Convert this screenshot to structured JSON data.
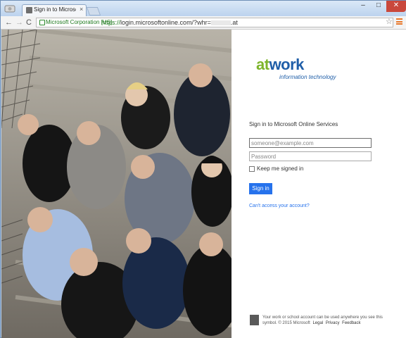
{
  "browser": {
    "tab_title": "Sign in to Microsoft Onlin",
    "tab_close": "×",
    "window_controls": {
      "minimize": "–",
      "maximize": "□",
      "close": "✕"
    },
    "nav": {
      "back": "←",
      "forward": "→",
      "reload": "C"
    },
    "address": {
      "organization": "Microsoft Corporation [US]",
      "url_scheme": "https://",
      "url_rest": "login.microsoftonline.com/?whr=",
      "url_tail": ".at"
    },
    "star": "☆"
  },
  "photo": {
    "description_icon": "team-photo"
  },
  "login": {
    "logo": {
      "at": "at",
      "work": "work",
      "subtitle": "information technology",
      "at_color": "#7db52b",
      "work_color": "#1f5ea8"
    },
    "heading": "Sign in to Microsoft Online Services",
    "email_placeholder": "someone@example.com",
    "password_placeholder": "Password",
    "keep_signed_in": "Keep me signed in",
    "sign_in": "Sign in",
    "cant_access": "Can't access your account?",
    "footer_text": "Your work or school account can be used anywhere you see this symbol. © 2015 Microsoft",
    "footer_links": [
      "Legal",
      "Privacy",
      "Feedback"
    ],
    "accent": "#2672ec"
  }
}
